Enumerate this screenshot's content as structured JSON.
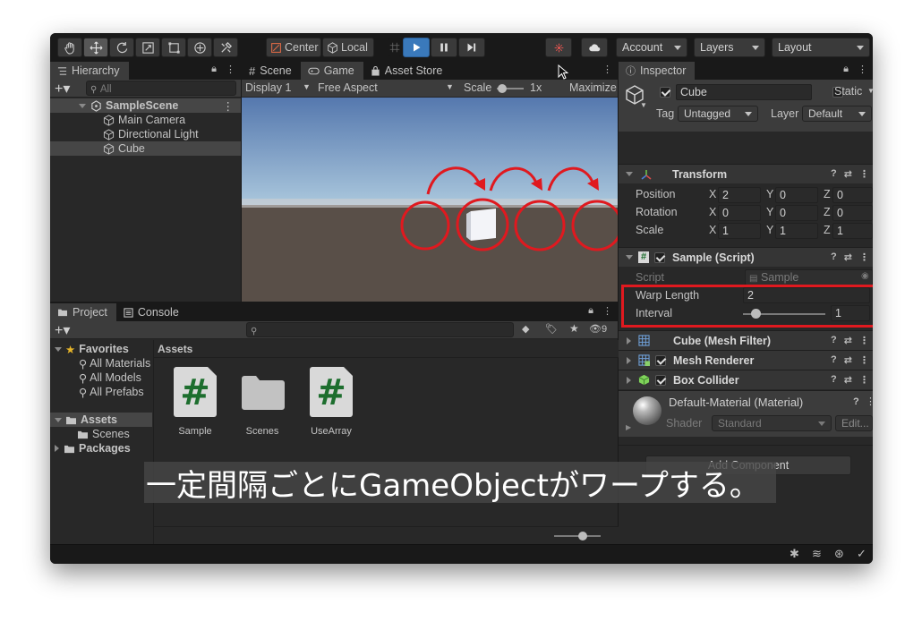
{
  "toolbar": {
    "pivot": "Center",
    "space": "Local",
    "account": "Account",
    "layers": "Layers",
    "layout": "Layout"
  },
  "hierarchy": {
    "tab": "Hierarchy",
    "search_placeholder": "All",
    "scene": "SampleScene",
    "items": [
      "Main Camera",
      "Directional Light",
      "Cube"
    ]
  },
  "center_tabs": {
    "scene": "Scene",
    "game": "Game",
    "asset_store": "Asset Store"
  },
  "game_bar": {
    "display": "Display 1",
    "aspect": "Free Aspect",
    "scale_label": "Scale",
    "scale_value": "1x",
    "maximize": "Maximize"
  },
  "project": {
    "tab": "Project",
    "console_tab": "Console",
    "hidden_count": "9",
    "favorites": "Favorites",
    "fav_items": [
      "All Materials",
      "All Models",
      "All Prefabs"
    ],
    "assets": "Assets",
    "asset_children": [
      "Scenes"
    ],
    "packages": "Packages",
    "assets_header": "Assets",
    "asset_items": [
      "Sample",
      "Scenes",
      "UseArray"
    ]
  },
  "inspector": {
    "tab": "Inspector",
    "object_name": "Cube",
    "static_label": "Static",
    "tag_label": "Tag",
    "tag_value": "Untagged",
    "layer_label": "Layer",
    "layer_value": "Default",
    "transform": {
      "title": "Transform",
      "rows": [
        {
          "label": "Position",
          "x": "2",
          "y": "0",
          "z": "0"
        },
        {
          "label": "Rotation",
          "x": "0",
          "y": "0",
          "z": "0"
        },
        {
          "label": "Scale",
          "x": "1",
          "y": "1",
          "z": "1"
        }
      ]
    },
    "sample": {
      "title": "Sample (Script)",
      "script_label": "Script",
      "script_value": "Sample",
      "warp_label": "Warp Length",
      "warp_value": "2",
      "interval_label": "Interval",
      "interval_value": "1"
    },
    "mesh_filter": "Cube (Mesh Filter)",
    "mesh_renderer": "Mesh Renderer",
    "box_collider": "Box Collider",
    "material": "Default-Material (Material)",
    "shader_label": "Shader",
    "shader_value": "Standard",
    "edit": "Edit...",
    "add_component": "Add Component"
  },
  "caption": "一定間隔ごとにGameObjectがワープする。",
  "colors": {
    "highlight": "#e0191f",
    "play_button": "#3a79bb",
    "script_icon": "#1d6e2e"
  }
}
